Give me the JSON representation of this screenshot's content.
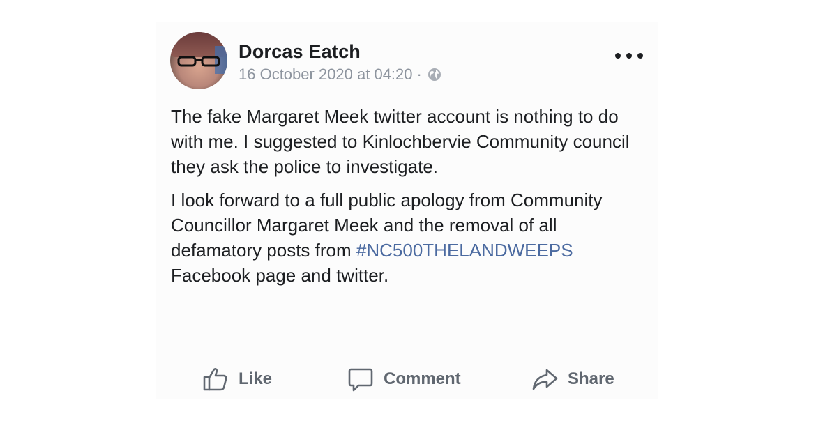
{
  "post": {
    "author": "Dorcas Eatch",
    "timestamp": "16 October 2020 at 04:20",
    "separator": "·",
    "privacy_icon": "globe-icon",
    "more_icon": "more-options-icon",
    "paragraph_1": "The fake Margaret Meek twitter account is nothing to do with me. I suggested to Kinlochbervie Community council they ask the police to investigate.",
    "paragraph_2_before": "I look forward to a full public apology from Community Councillor Margaret Meek and the removal of all defamatory posts from ",
    "hashtag": "#NC500THELANDWEEPS",
    "paragraph_2_after": " Facebook page and twitter."
  },
  "actions": {
    "like_label": "Like",
    "comment_label": "Comment",
    "share_label": "Share"
  },
  "colors": {
    "text": "#1c1e21",
    "meta": "#8d949e",
    "hashtag": "#4b6aa0",
    "action": "#606770"
  }
}
